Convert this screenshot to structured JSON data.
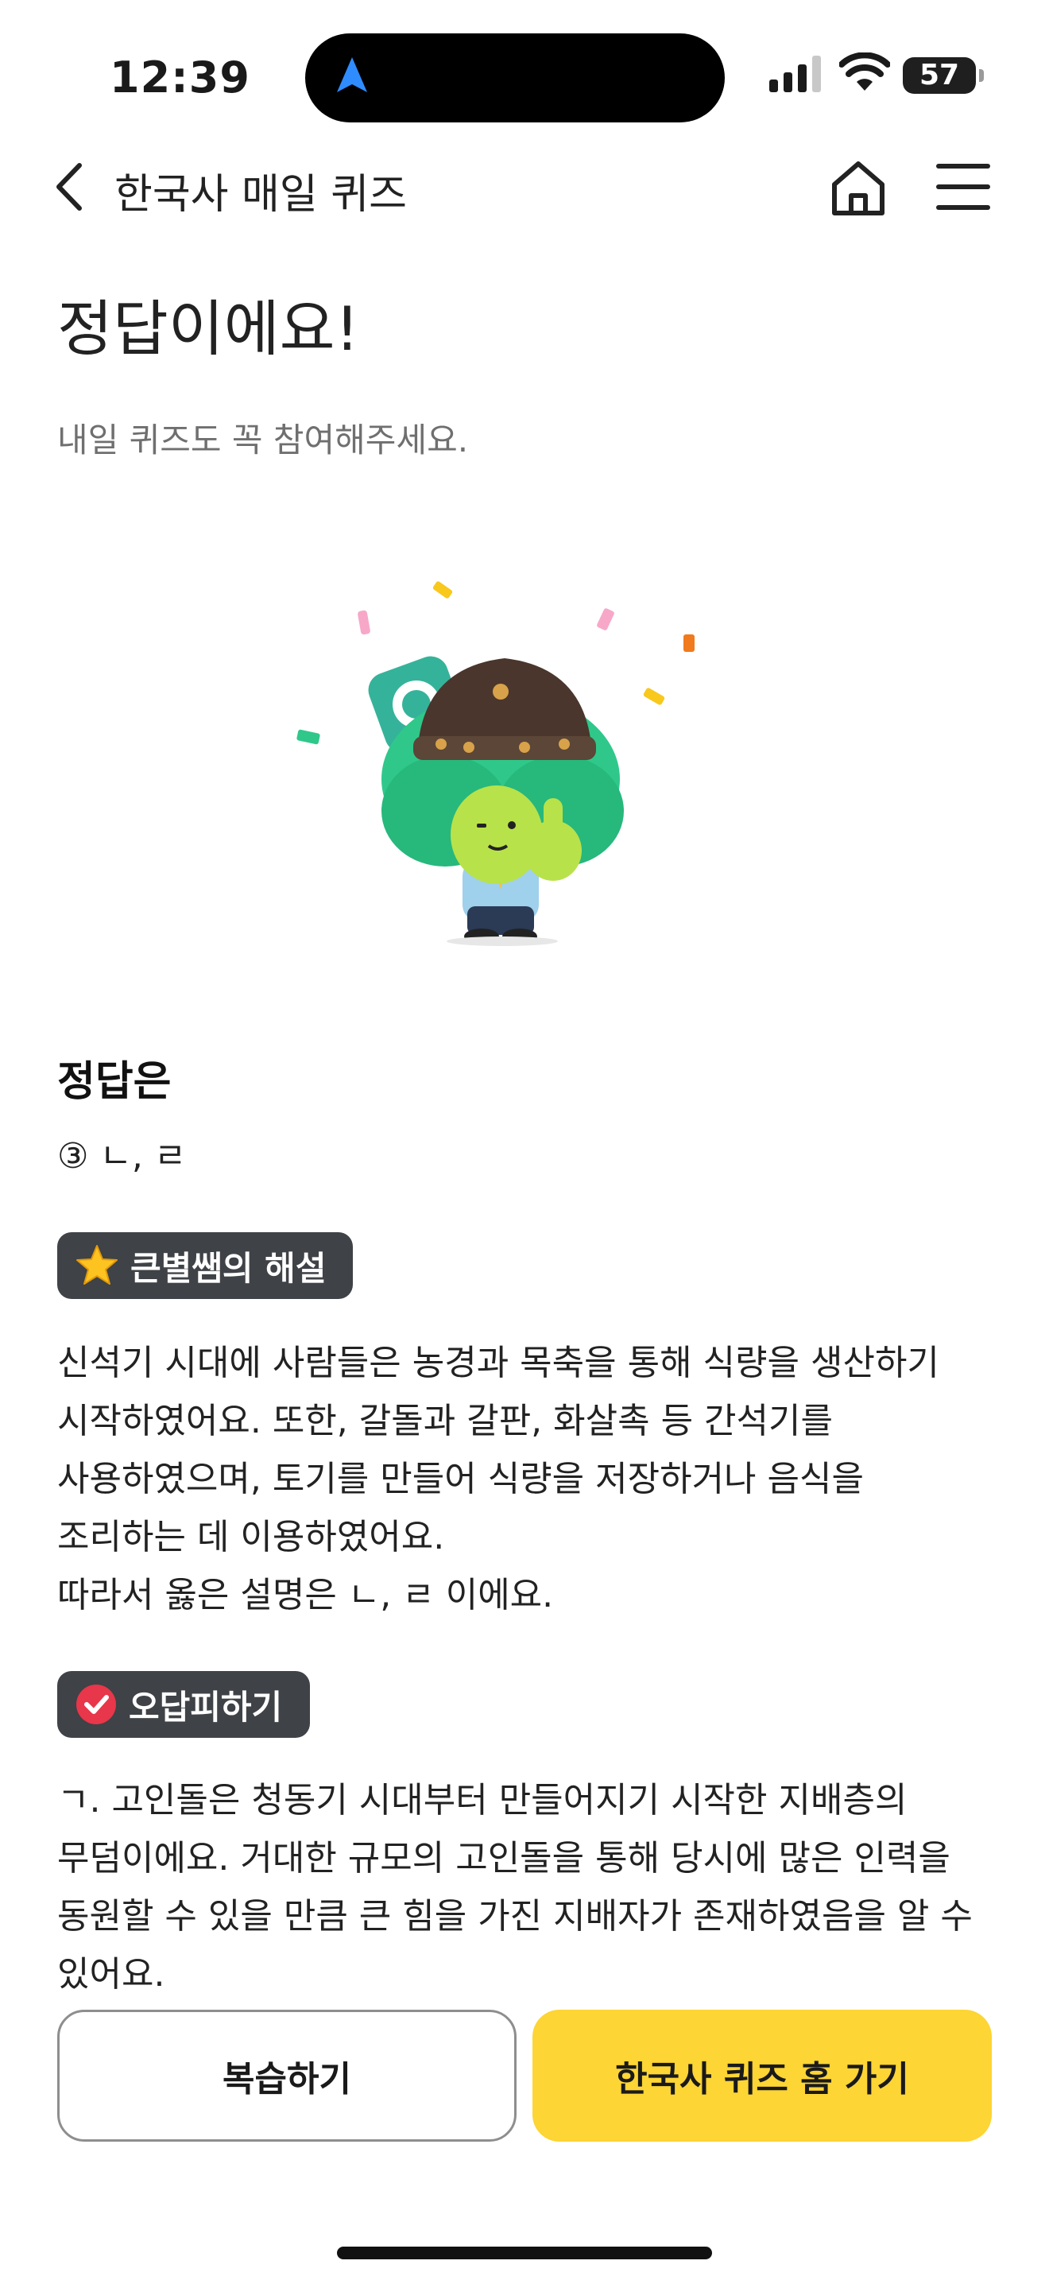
{
  "status_bar": {
    "time": "12:39",
    "battery": "57"
  },
  "nav": {
    "title": "한국사 매일 퀴즈"
  },
  "result": {
    "headline": "정답이에요!",
    "subtext": "내일 퀴즈도 꼭 참여해주세요."
  },
  "answer": {
    "title": "정답은",
    "text": "③ ㄴ, ㄹ"
  },
  "explanation": {
    "badge_label": "큰별쌤의 해설",
    "lines": [
      "신석기 시대에 사람들은 농경과 목축을 통해 식량을 생산하기",
      "시작하였어요. 또한, 갈돌과 갈판, 화살촉 등 간석기를",
      "사용하였으며, 토기를 만들어 식량을 저장하거나 음식을",
      "조리하는 데 이용하였어요.",
      "따라서 옳은 설명은 ㄴ, ㄹ 이에요."
    ]
  },
  "wrong_answers": {
    "badge_label": "오답피하기",
    "lines": [
      "ㄱ. 고인돌은 청동기 시대부터 만들어지기 시작한 지배층의",
      "무덤이에요. 거대한 규모의 고인돌을 통해 당시에 많은 인력을",
      "동원할 수 있을 만큼 큰 힘을 가진 지배자가 존재하였음을 알 수",
      "있어요."
    ]
  },
  "buttons": {
    "review": "복습하기",
    "quiz_home": "한국사 퀴즈 홈 가기"
  },
  "colors": {
    "accent_yellow": "#FDD534",
    "badge_bg": "#3F4246",
    "mascot_green": "#2FC88A",
    "check_red": "#E8364A"
  },
  "icons": [
    "navigation-arrow-icon",
    "signal-icon",
    "wifi-icon",
    "battery-icon",
    "back-chevron-icon",
    "home-icon",
    "menu-icon",
    "star-icon",
    "check-circle-icon"
  ]
}
